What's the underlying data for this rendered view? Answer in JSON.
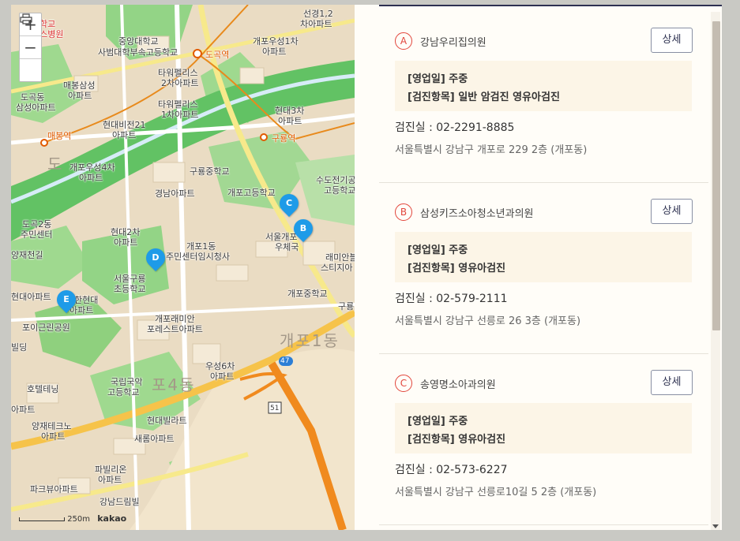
{
  "map": {
    "zoom_in": "+",
    "zoom_out": "−",
    "print_icon": "printer-icon",
    "scale_label": "250m",
    "logo": "kakao",
    "labels": [
      {
        "text": "학교",
        "name": "label-school-top"
      },
      {
        "text": "상스병원",
        "name": "label-hospital"
      },
      {
        "text": "중앙대학교",
        "name": "label-chungang"
      },
      {
        "text": "사범대학부속고등학교",
        "name": "label-chungang-hs"
      },
      {
        "text": "도곡역",
        "name": "label-dogok-station"
      },
      {
        "text": "개포우성1차",
        "name": "label-woosung1"
      },
      {
        "text": "아파트",
        "name": "label-woosung1-apt"
      },
      {
        "text": "선경1,2",
        "name": "label-sungyung"
      },
      {
        "text": "차아파트",
        "name": "label-sungyung-apt"
      },
      {
        "text": "매봉삼성",
        "name": "label-maebong-samsung"
      },
      {
        "text": "아파트",
        "name": "label-maebong-apt"
      },
      {
        "text": "타워펠리스",
        "name": "label-tower2"
      },
      {
        "text": "2차아파트",
        "name": "label-tower2-apt"
      },
      {
        "text": "타워펠리스",
        "name": "label-tower1"
      },
      {
        "text": "1차아파트",
        "name": "label-tower1-apt"
      },
      {
        "text": "현대3차",
        "name": "label-hyundai3"
      },
      {
        "text": "아파트",
        "name": "label-hyundai3-apt"
      },
      {
        "text": "도곡동",
        "name": "label-dogok-dong"
      },
      {
        "text": "삼성아파트",
        "name": "label-dogok-samsung"
      },
      {
        "text": "매봉역",
        "name": "label-maebong-station"
      },
      {
        "text": "현대비전21",
        "name": "label-vision21"
      },
      {
        "text": "아파트",
        "name": "label-vision21-apt"
      },
      {
        "text": "구룡역",
        "name": "label-guryong-station"
      },
      {
        "text": "도",
        "name": "label-big-do"
      },
      {
        "text": "개포우성4차",
        "name": "label-woosung4"
      },
      {
        "text": "아파트",
        "name": "label-woosung4-apt"
      },
      {
        "text": "구룡중학교",
        "name": "label-guryong-ms"
      },
      {
        "text": "개포고등학교",
        "name": "label-gaepo-hs"
      },
      {
        "text": "수도전기공",
        "name": "label-sudo"
      },
      {
        "text": "고등학교",
        "name": "label-sudo-hs"
      },
      {
        "text": "경남아파트",
        "name": "label-gyeongnam"
      },
      {
        "text": "도곡2동",
        "name": "label-dogok2"
      },
      {
        "text": "주민센터",
        "name": "label-dogok2-center"
      },
      {
        "text": "현대2차",
        "name": "label-hyundai2"
      },
      {
        "text": "아파트",
        "name": "label-hyundai2-apt"
      },
      {
        "text": "개포1동",
        "name": "label-gaepo1"
      },
      {
        "text": "주민센터임시청사",
        "name": "label-gaepo1-center"
      },
      {
        "text": "서울개포",
        "name": "label-post"
      },
      {
        "text": "우체국",
        "name": "label-post-office"
      },
      {
        "text": "양재천길",
        "name": "label-yangjae"
      },
      {
        "text": "래미안블",
        "name": "label-raemian-bl"
      },
      {
        "text": "스티지아",
        "name": "label-raemian-st"
      },
      {
        "text": "서울구룡",
        "name": "label-guryong-es"
      },
      {
        "text": "초등학교",
        "name": "label-guryong-es2"
      },
      {
        "text": "개포중학교",
        "name": "label-gaepo-ms"
      },
      {
        "text": "현대아파트",
        "name": "label-hyundai-apt"
      },
      {
        "text": "한현대",
        "name": "label-hanhyundai"
      },
      {
        "text": "아파트",
        "name": "label-hanhyundai-apt"
      },
      {
        "text": "구룡",
        "name": "label-guryong-right"
      },
      {
        "text": "포이근린공원",
        "name": "label-poi-park"
      },
      {
        "text": "개포래미안",
        "name": "label-raemian-forest"
      },
      {
        "text": "포레스트아파트",
        "name": "label-raemian-forest2"
      },
      {
        "text": "개포1동",
        "name": "label-big-gaepo1"
      },
      {
        "text": "빌딩",
        "name": "label-building"
      },
      {
        "text": "우성6차",
        "name": "label-woosung6"
      },
      {
        "text": "아파트",
        "name": "label-woosung6-apt"
      },
      {
        "text": "호텔테닝",
        "name": "label-hotel"
      },
      {
        "text": "국립국악",
        "name": "label-gugak"
      },
      {
        "text": "고등학교",
        "name": "label-gugak-hs"
      },
      {
        "text": "포4동",
        "name": "label-big-gaepo4"
      },
      {
        "text": "아파트",
        "name": "label-apt-left"
      },
      {
        "text": "현대빌라트",
        "name": "label-hyundai-villa"
      },
      {
        "text": "양재테크노",
        "name": "label-techno"
      },
      {
        "text": "아파트",
        "name": "label-techno-apt"
      },
      {
        "text": "새롬아파트",
        "name": "label-saerom"
      },
      {
        "text": "파빌리온",
        "name": "label-pavilion"
      },
      {
        "text": "아파트",
        "name": "label-pavilion-apt"
      },
      {
        "text": "파크뷰아파트",
        "name": "label-parkview"
      },
      {
        "text": "강남드림빌",
        "name": "label-dreamville"
      },
      {
        "text": "47",
        "name": "label-route-47"
      },
      {
        "text": "51",
        "name": "label-route-51"
      }
    ],
    "markers": [
      "A",
      "B",
      "C",
      "D",
      "E"
    ]
  },
  "clinics": [
    {
      "letter": "A",
      "name": "강남우리집의원",
      "detail_label": "상세",
      "days": "[영업일] 주중",
      "exams": "[검진항목] 일반 암검진 영유아검진",
      "phone": "검진실 : 02-2291-8885",
      "address": "서울특별시 강남구 개포로 229 2층 (개포동)"
    },
    {
      "letter": "B",
      "name": "삼성키즈소아청소년과의원",
      "detail_label": "상세",
      "days": "[영업일] 주중",
      "exams": "[검진항목] 영유아검진",
      "phone": "검진실 : 02-579-2111",
      "address": "서울특별시 강남구 선릉로 26 3층 (개포동)"
    },
    {
      "letter": "C",
      "name": "송영명소아과의원",
      "detail_label": "상세",
      "days": "[영업일] 주중",
      "exams": "[검진항목] 영유아검진",
      "phone": "검진실 : 02-573-6227",
      "address": "서울특별시 강남구 선릉로10길 5 2층 (개포동)"
    }
  ],
  "colors": {
    "accent_red": "#e2463c",
    "marker_blue": "#1e9be8",
    "info_bg": "#fcf5e7",
    "header_line": "#2d2f52"
  }
}
